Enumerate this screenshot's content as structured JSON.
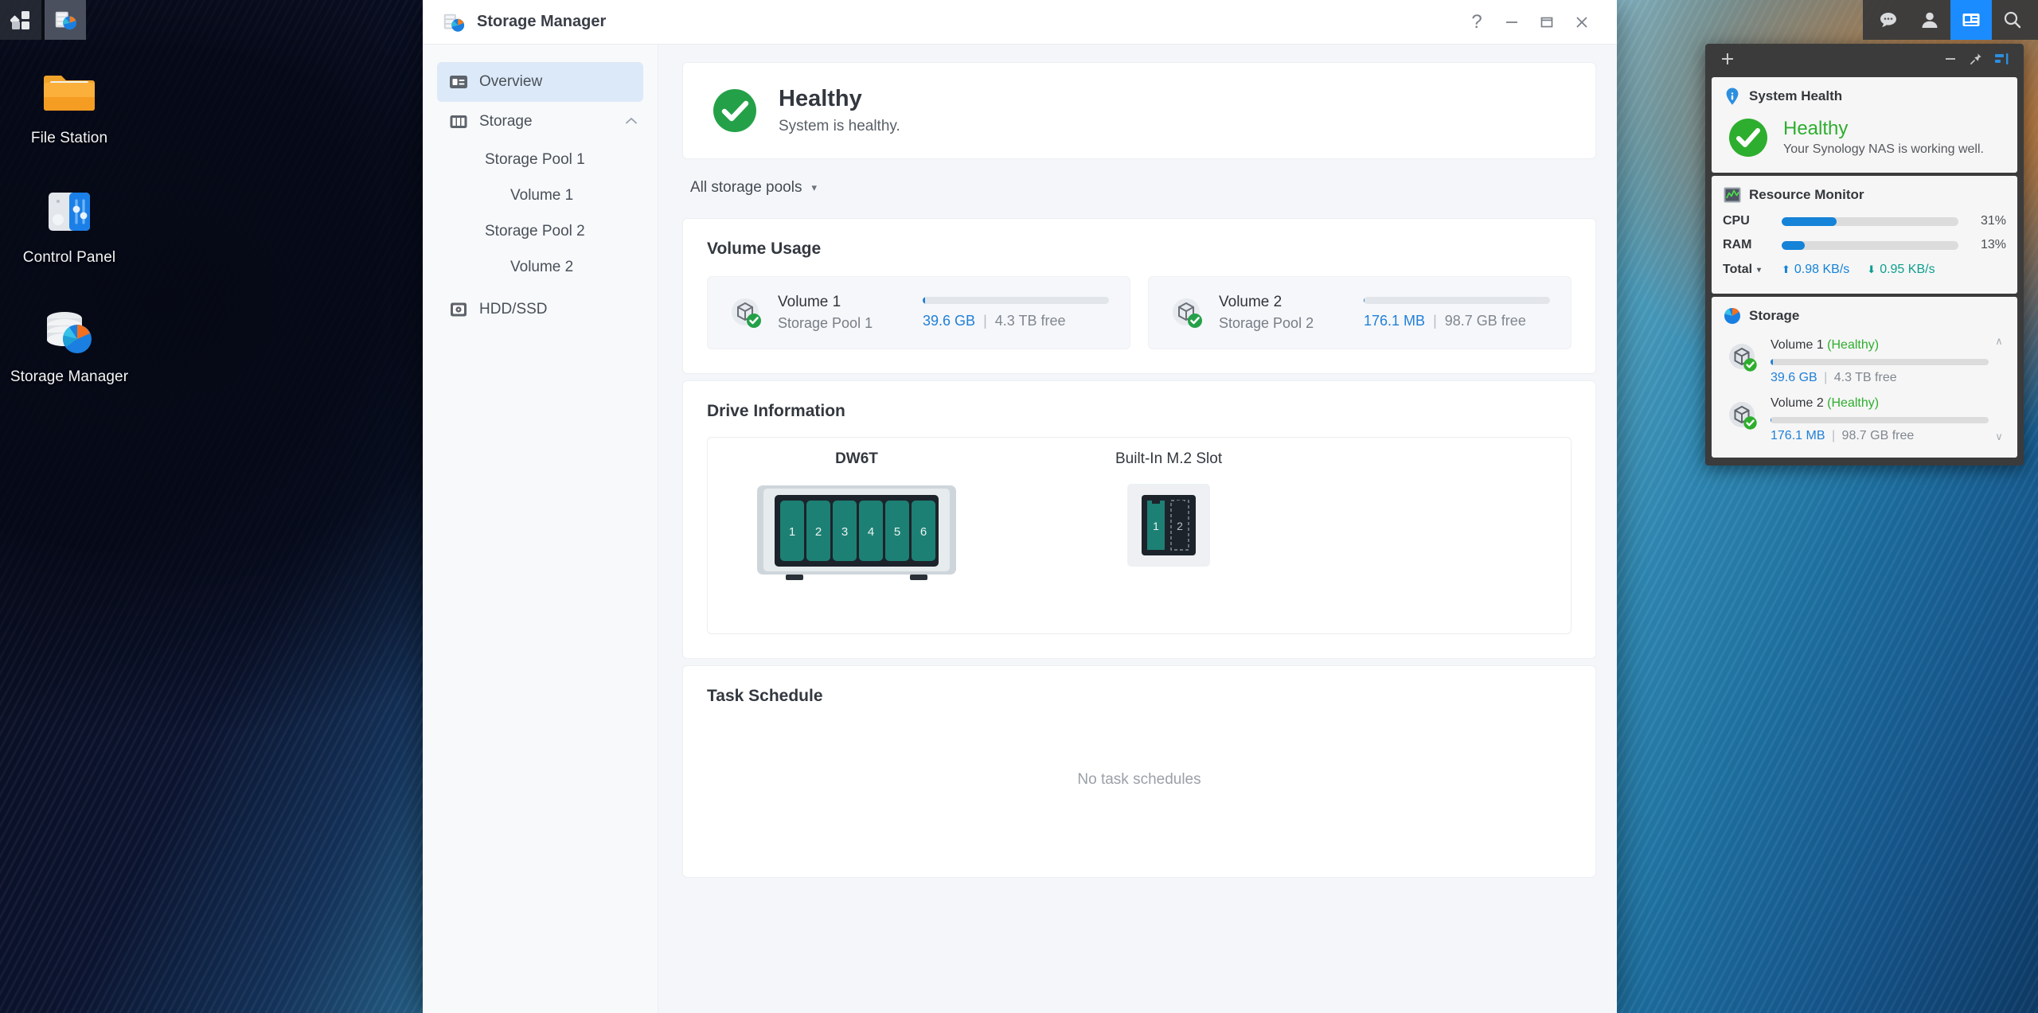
{
  "taskbar": {
    "left_items": [
      {
        "name": "main-menu",
        "icon": "grid-squares-icon"
      },
      {
        "name": "taskbar-storage-manager",
        "icon": "storage-manager-icon"
      }
    ],
    "right_items": [
      {
        "name": "notifications",
        "icon": "chat-bubble-icon"
      },
      {
        "name": "user-account",
        "icon": "person-icon"
      },
      {
        "name": "widgets-toggle",
        "icon": "widget-panel-icon"
      },
      {
        "name": "search",
        "icon": "search-icon"
      }
    ]
  },
  "desktop_icons": [
    {
      "label": "File Station",
      "icon": "folder-icon"
    },
    {
      "label": "Control Panel",
      "icon": "sliders-icon"
    },
    {
      "label": "Storage Manager",
      "icon": "disk-pie-icon"
    }
  ],
  "window": {
    "title": "Storage Manager",
    "app_icon": "storage-manager-icon",
    "controls": [
      {
        "name": "help",
        "glyph": "?"
      },
      {
        "name": "minimize",
        "glyph": "–"
      },
      {
        "name": "maximize",
        "glyph": "❐"
      },
      {
        "name": "close",
        "glyph": "✕"
      }
    ]
  },
  "sidebar": {
    "items": [
      {
        "label": "Overview",
        "icon": "overview-card-icon",
        "selected": true,
        "level": 0
      },
      {
        "label": "Storage",
        "icon": "storage-bays-icon",
        "selected": false,
        "level": 0,
        "chevron": "∧"
      },
      {
        "label": "Storage Pool 1",
        "level": 1
      },
      {
        "label": "Volume 1",
        "level": 2
      },
      {
        "label": "Storage Pool 2",
        "level": 1
      },
      {
        "label": "Volume 2",
        "level": 2
      },
      {
        "label": "HDD/SSD",
        "icon": "hdd-icon",
        "selected": false,
        "level": 0
      }
    ]
  },
  "main": {
    "health": {
      "title": "Healthy",
      "subtitle": "System is healthy.",
      "icon": "green-check-icon",
      "color": "#24a148"
    },
    "pool_filter": {
      "label": "All storage pools",
      "caret": "▾"
    },
    "volume_usage": {
      "section_title": "Volume Usage",
      "volumes": [
        {
          "name": "Volume 1",
          "pool": "Storage Pool 1",
          "used": "39.6 GB",
          "free": "4.3 TB free",
          "separator": "|",
          "percent": 1,
          "icon": "volume-cube-icon",
          "status": "healthy"
        },
        {
          "name": "Volume 2",
          "pool": "Storage Pool 2",
          "used": "176.1 MB",
          "free": "98.7 GB free",
          "separator": "|",
          "percent": 0,
          "icon": "volume-cube-icon",
          "status": "healthy"
        }
      ]
    },
    "drive_information": {
      "section_title": "Drive Information",
      "units": [
        {
          "name": "DW6T",
          "type": "bay-enclosure",
          "bold": true,
          "bays": [
            {
              "label": "1",
              "occupied": true
            },
            {
              "label": "2",
              "occupied": true
            },
            {
              "label": "3",
              "occupied": true
            },
            {
              "label": "4",
              "occupied": true
            },
            {
              "label": "5",
              "occupied": true
            },
            {
              "label": "6",
              "occupied": true
            }
          ]
        },
        {
          "name": "Built-In M.2 Slot",
          "type": "m2-slot",
          "bold": false,
          "bays": [
            {
              "label": "1",
              "occupied": true
            },
            {
              "label": "2",
              "occupied": false
            }
          ]
        }
      ],
      "drive_fill_color": "#1d8074"
    },
    "task_schedule": {
      "section_title": "Task Schedule",
      "empty_text": "No task schedules"
    }
  },
  "widgets": {
    "header": {
      "add": "+",
      "minimize": "–",
      "pin_icon": "pin-icon",
      "dock_icon": "dock-right-icon"
    },
    "system_health": {
      "title": "System Health",
      "icon": "info-pin-icon",
      "status": "Healthy",
      "message": "Your Synology NAS is working well.",
      "status_color": "#2eae2e"
    },
    "resource_monitor": {
      "title": "Resource Monitor",
      "icon": "chart-icon",
      "metrics": [
        {
          "label": "CPU",
          "value": "31%",
          "percent": 31
        },
        {
          "label": "RAM",
          "value": "13%",
          "percent": 13
        }
      ],
      "total": {
        "label": "Total",
        "caret": "▾",
        "upload": "0.98 KB/s",
        "download": "0.95 KB/s",
        "up_arrow": "⬆",
        "down_arrow": "⬇"
      }
    },
    "storage": {
      "title": "Storage",
      "icon": "pie-icon",
      "volumes": [
        {
          "name": "Volume 1",
          "status": "Healthy",
          "used": "39.6 GB",
          "separator": "|",
          "free": "4.3 TB free",
          "percent": 1
        },
        {
          "name": "Volume 2",
          "status": "Healthy",
          "used": "176.1 MB",
          "separator": "|",
          "free": "98.7 GB free",
          "percent": 0
        }
      ],
      "scroll_up": "∧",
      "scroll_down": "∨"
    }
  }
}
